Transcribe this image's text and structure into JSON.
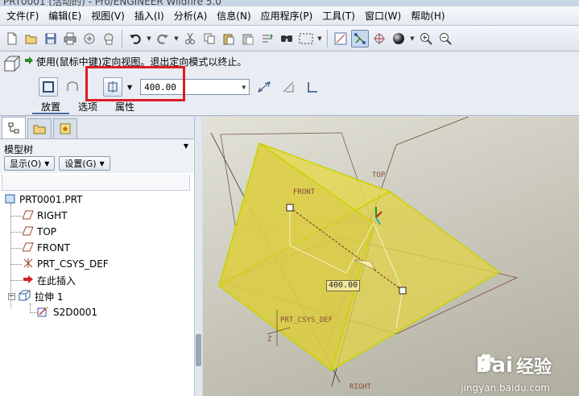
{
  "window": {
    "title": "PRT0001 (活动的) - Pro/ENGINEER Wildfire 5.0"
  },
  "menu": [
    {
      "label": "文件(F)"
    },
    {
      "label": "编辑(E)"
    },
    {
      "label": "视图(V)"
    },
    {
      "label": "插入(I)"
    },
    {
      "label": "分析(A)"
    },
    {
      "label": "信息(N)"
    },
    {
      "label": "应用程序(P)"
    },
    {
      "label": "工具(T)"
    },
    {
      "label": "窗口(W)"
    },
    {
      "label": "帮助(H)"
    }
  ],
  "toolbar_icons": [
    "new-icon",
    "open-icon",
    "save-icon",
    "print-icon",
    "send-icon",
    "email-icon",
    "undo-icon",
    "redo-icon",
    "cut-icon",
    "copy-icon",
    "paste-icon",
    "paste-special-icon",
    "regenerate-icon",
    "find-icon",
    "select-box-icon",
    "sketch-view-icon",
    "datum-display-icon",
    "spin-center-icon",
    "shading-icon",
    "zoom-in-icon",
    "zoom-out-icon"
  ],
  "dashboard": {
    "message": "使用(鼠标中键)定向视图。退出定向模式以终止。",
    "depth_value": "400.00",
    "tabs": [
      {
        "label": "放置",
        "active": true
      },
      {
        "label": "选项",
        "active": false
      },
      {
        "label": "属性",
        "active": false
      }
    ],
    "highlight_color": "#e01b24"
  },
  "model_tree": {
    "title": "模型树",
    "show_button": "显示(O)",
    "settings_button": "设置(G)",
    "nodes": [
      {
        "label": "PRT0001.PRT",
        "type": "part"
      },
      {
        "label": "RIGHT",
        "type": "datum-plane"
      },
      {
        "label": "TOP",
        "type": "datum-plane"
      },
      {
        "label": "FRONT",
        "type": "datum-plane"
      },
      {
        "label": "PRT_CSYS_DEF",
        "type": "csys"
      },
      {
        "label": "在此插入",
        "type": "insert-here"
      },
      {
        "label": "拉伸 1",
        "type": "extrude"
      },
      {
        "label": "S2D0001",
        "type": "sketch"
      }
    ]
  },
  "viewport": {
    "labels": {
      "front": "FRONT",
      "top": "TOP",
      "right": "RIGHT",
      "csys": "PRT_CSYS_DEF",
      "csys_z": "Z",
      "dimension": "400.00"
    },
    "solid_color": "#e6d84e",
    "edge_color": "#c7d400"
  },
  "watermark": {
    "brand": "Bai",
    "brand2": "经验",
    "url": "jingyan.baidu.com"
  }
}
